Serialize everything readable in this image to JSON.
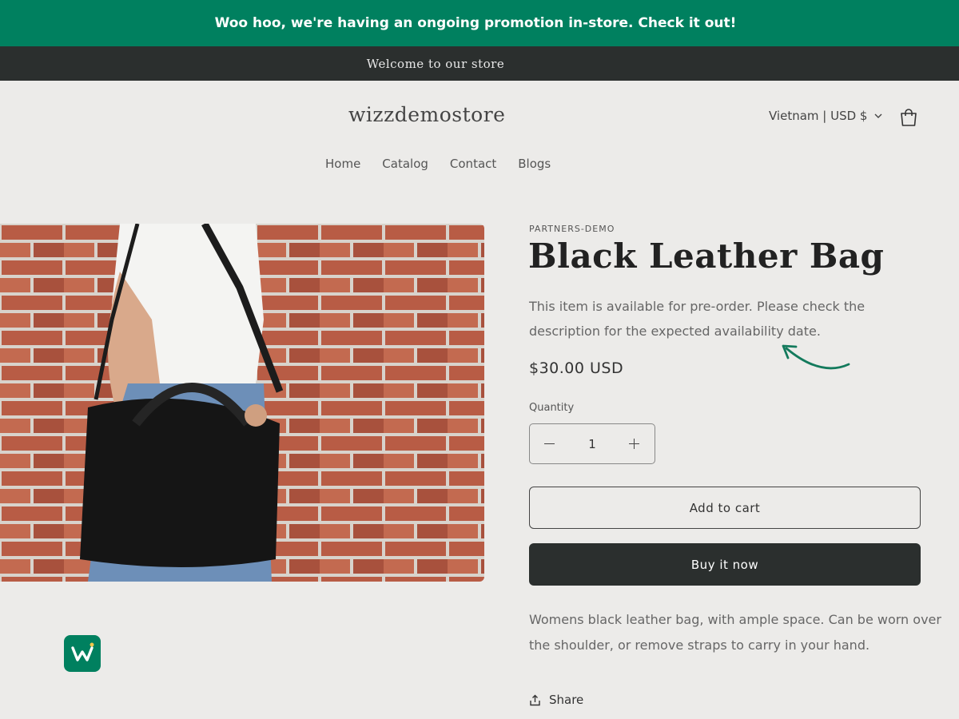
{
  "announcement": {
    "promo_text": "Woo hoo, we're having an ongoing promotion in-store. Check it out!",
    "welcome_text": "Welcome to our store"
  },
  "header": {
    "store_name": "wizzdemostore",
    "locale_selector": "Vietnam | USD $",
    "cart_icon": "cart-icon"
  },
  "nav": {
    "items": [
      "Home",
      "Catalog",
      "Contact",
      "Blogs"
    ]
  },
  "product": {
    "vendor": "PARTNERS-DEMO",
    "title": "Black Leather Bag",
    "preorder_notice": "This item is available for pre-order. Please check the description for the expected availability date.",
    "price": "$30.00 USD",
    "quantity_label": "Quantity",
    "quantity_value": "1",
    "add_to_cart_label": "Add to cart",
    "buy_now_label": "Buy it now",
    "description": "Womens black leather bag, with ample space. Can be worn over the shoulder, or remove straps to carry in your hand.",
    "share_label": "Share"
  },
  "colors": {
    "brand_green": "#00805f",
    "dark": "#2b2f2e",
    "background": "#ecebe9"
  }
}
